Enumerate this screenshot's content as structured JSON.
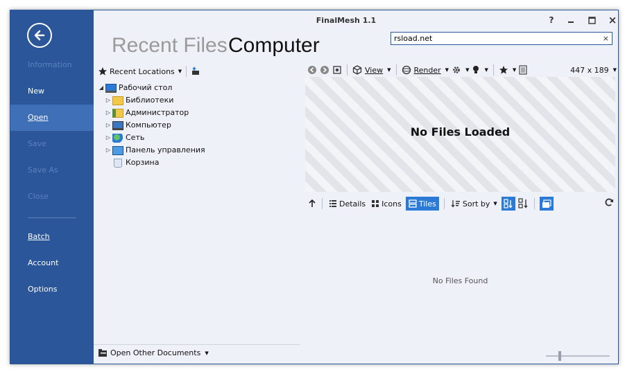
{
  "window": {
    "title": "FinalMesh 1.1",
    "help": "?",
    "minimize": "–",
    "close": "×"
  },
  "sidebar": {
    "items": [
      {
        "label": "Information"
      },
      {
        "label": "New"
      },
      {
        "label": "Open"
      },
      {
        "label": "Save"
      },
      {
        "label": "Save As"
      },
      {
        "label": "Close"
      },
      {
        "label": "Batch"
      },
      {
        "label": "Account"
      },
      {
        "label": "Options"
      }
    ]
  },
  "tabs": {
    "recent": "Recent Files",
    "computer": "Computer"
  },
  "search": {
    "value": "rsload.net",
    "clear": "×"
  },
  "left_panel": {
    "recent_locations": "Recent Locations",
    "tree": [
      {
        "label": "Рабочий стол"
      },
      {
        "label": "Библиотеки"
      },
      {
        "label": "Администратор"
      },
      {
        "label": "Компьютер"
      },
      {
        "label": "Сеть"
      },
      {
        "label": "Панель управления"
      },
      {
        "label": "Корзина"
      }
    ],
    "footer": "Open Other Documents"
  },
  "preview_toolbar": {
    "view": "View",
    "render": "Render",
    "size": "447 x 189"
  },
  "preview": {
    "message": "No Files Loaded"
  },
  "list_toolbar": {
    "details": "Details",
    "icons": "Icons",
    "tiles": "Tiles",
    "sort_by": "Sort by"
  },
  "list": {
    "empty_message": "No Files Found"
  },
  "colors": {
    "accent": "#2b579a",
    "selected": "#2b7bd6"
  }
}
